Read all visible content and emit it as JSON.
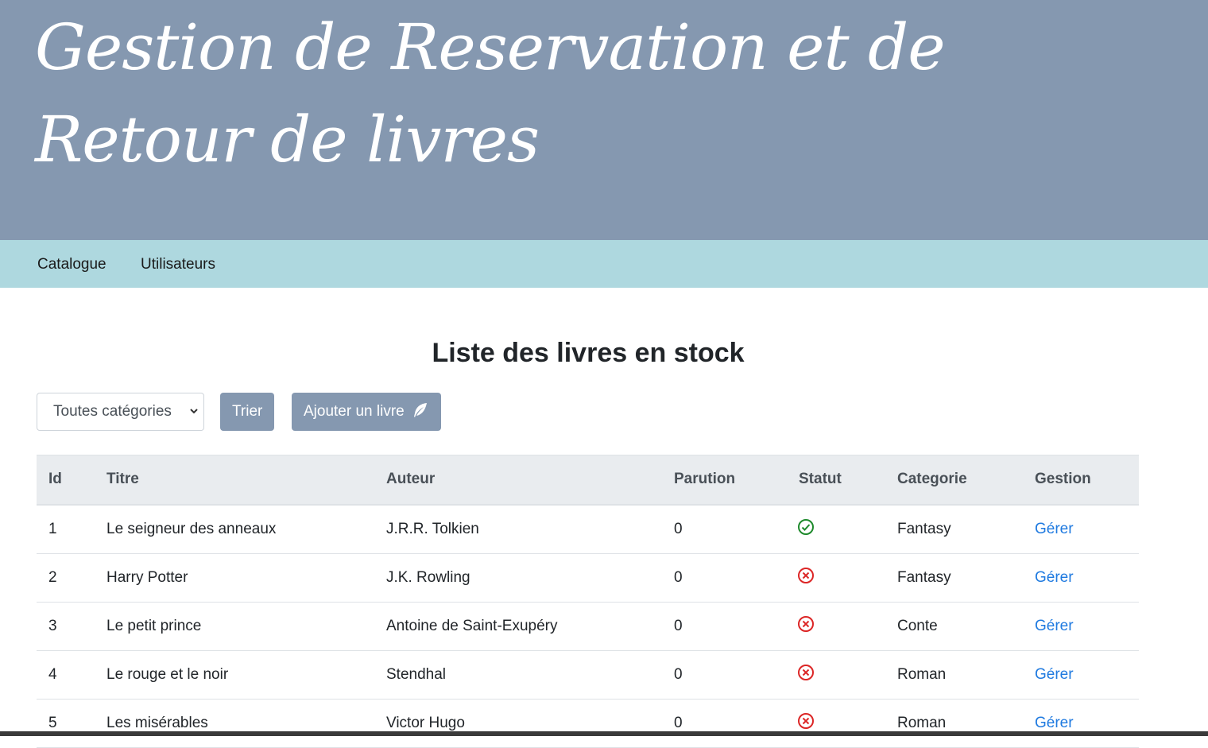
{
  "header": {
    "title": "Gestion de Reservation et de Retour de livres"
  },
  "nav": {
    "items": [
      {
        "label": "Catalogue"
      },
      {
        "label": "Utilisateurs"
      }
    ]
  },
  "main": {
    "title": "Liste des livres en stock",
    "filter": {
      "selected": "Toutes catégories"
    },
    "sort_button": "Trier",
    "add_button": "Ajouter un livre",
    "add_icon": "feather-icon"
  },
  "table": {
    "headers": [
      "Id",
      "Titre",
      "Auteur",
      "Parution",
      "Statut",
      "Categorie",
      "Gestion"
    ],
    "rows": [
      {
        "id": "1",
        "titre": "Le seigneur des anneaux",
        "auteur": "J.R.R. Tolkien",
        "parution": "0",
        "statut": "available",
        "categorie": "Fantasy",
        "gestion": "Gérer"
      },
      {
        "id": "2",
        "titre": "Harry Potter",
        "auteur": "J.K. Rowling",
        "parution": "0",
        "statut": "unavailable",
        "categorie": "Fantasy",
        "gestion": "Gérer"
      },
      {
        "id": "3",
        "titre": "Le petit prince",
        "auteur": "Antoine de Saint-Exupéry",
        "parution": "0",
        "statut": "unavailable",
        "categorie": "Conte",
        "gestion": "Gérer"
      },
      {
        "id": "4",
        "titre": "Le rouge et le noir",
        "auteur": "Stendhal",
        "parution": "0",
        "statut": "unavailable",
        "categorie": "Roman",
        "gestion": "Gérer"
      },
      {
        "id": "5",
        "titre": "Les misérables",
        "auteur": "Victor Hugo",
        "parution": "0",
        "statut": "unavailable",
        "categorie": "Roman",
        "gestion": "Gérer"
      }
    ]
  },
  "colors": {
    "header_bg": "#8598b0",
    "nav_bg": "#aed8df",
    "link": "#1f7ae0",
    "status_ok": "#1e8a2c",
    "status_no": "#dc2626"
  }
}
